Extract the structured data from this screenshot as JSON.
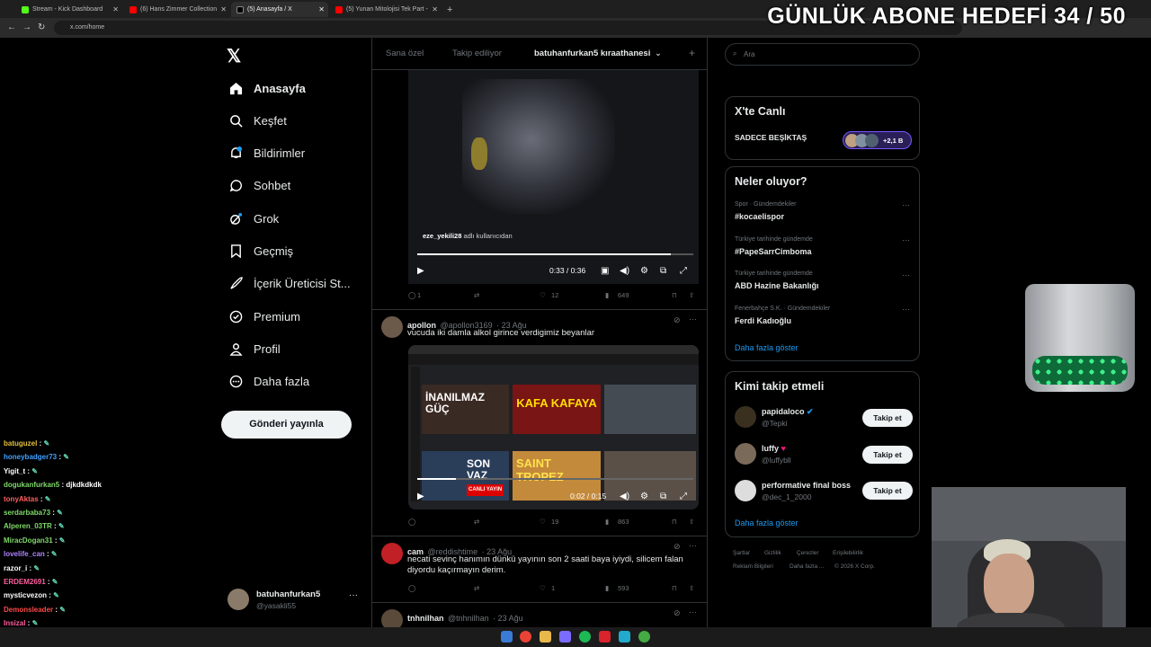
{
  "browser": {
    "tabs": [
      {
        "title": "Stream - Kick Dashboard",
        "color": "#53fc18",
        "active": false
      },
      {
        "title": "(6) Hans Zimmer Collection",
        "color": "#ff0000",
        "active": false
      },
      {
        "title": "(5) Anasayfa / X",
        "color": "#000000",
        "active": true
      },
      {
        "title": "(5) Yunan Mitolojisi Tek Part -",
        "color": "#ff0000",
        "active": false
      }
    ],
    "url": "x.com/home"
  },
  "overlay": {
    "goal_text": "GÜNLÜK ABONE HEDEFİ 34 / 50"
  },
  "sidebar": {
    "items": [
      {
        "label": "Anasayfa",
        "icon": "home-icon"
      },
      {
        "label": "Keşfet",
        "icon": "search-icon"
      },
      {
        "label": "Bildirimler",
        "icon": "bell-icon"
      },
      {
        "label": "Sohbet",
        "icon": "chat-icon"
      },
      {
        "label": "Grok",
        "icon": "grok-icon"
      },
      {
        "label": "Geçmiş",
        "icon": "bookmark-icon"
      },
      {
        "label": "İçerik Üreticisi St...",
        "icon": "rocket-icon"
      },
      {
        "label": "Premium",
        "icon": "premium-icon"
      },
      {
        "label": "Profil",
        "icon": "profile-icon"
      },
      {
        "label": "Daha fazla",
        "icon": "more-icon"
      }
    ],
    "post_button": "Gönderi yayınla",
    "account": {
      "name": "batuhanfurkan5",
      "handle": "@yasakli55"
    }
  },
  "timeline": {
    "tabs": [
      "Sana özel",
      "Takip ediliyor",
      "batuhanfurkan5 kıraathanesi"
    ],
    "video1": {
      "caption": "eze_yekili28 adlı kullanıcıdan",
      "time": "0:33 / 0:36",
      "replies": "1",
      "likes": "12",
      "views": "649"
    },
    "post2": {
      "name": "apollon",
      "handle": "@apollon3169",
      "date": "· 23 Ağu",
      "text": "vucuda iki damla alkol girince verdigimiz beyanlar",
      "time": "0:02 / 0:15",
      "likes": "19",
      "views": "863",
      "thumbs": [
        "İNANILMAZ GÜÇ",
        "KAFA KAFAYA",
        "SON VAZ",
        "SAINT TROPEZ",
        "CANLI YAYIN"
      ]
    },
    "post3": {
      "name": "cam",
      "handle": "@reddishtime",
      "date": "· 23 Ağu",
      "text1": "necati sevinç hanımın dünkü yayının son 2 saati baya iyiydi, silicem falan",
      "text2": "diyordu kaçırmayın derim.",
      "likes": "1",
      "views": "593"
    },
    "post4": {
      "name": "tnhnilhan",
      "handle": "@tnhnilhan",
      "date": "· 23 Ağu"
    }
  },
  "right": {
    "search_placeholder": "Ara",
    "live": {
      "title": "X'te Canlı",
      "stream": "SADECE BEŞİKTAŞ",
      "count": "+2,1 B"
    },
    "trends": {
      "title": "Neler oluyor?",
      "items": [
        {
          "meta": "Spor · Gündemdekiler",
          "tag": "#kocaelispor"
        },
        {
          "meta": "Türkiye tarihinde gündemde",
          "tag": "#PapeSarrCimboma"
        },
        {
          "meta": "Türkiye tarihinde gündemde",
          "tag": "ABD Hazine Bakanlığı"
        },
        {
          "meta": "Fenerbahçe S.K. · Gündemdekiler",
          "tag": "Ferdi Kadıoğlu"
        }
      ],
      "show_more": "Daha fazla göster"
    },
    "who": {
      "title": "Kimi takip etmeli",
      "items": [
        {
          "name": "papidaloco",
          "handle": "@Tepki"
        },
        {
          "name": "luffy",
          "handle": "@luffybll"
        },
        {
          "name": "performative final boss",
          "handle": "@dec_1_2000"
        }
      ],
      "follow_label": "Takip et",
      "show_more": "Daha fazla göster"
    },
    "footer": [
      "Şartlar",
      "Gizlilik",
      "Çerezler",
      "Erişilebilirlik",
      "Reklam Bilgileri",
      "Daha fazla ...",
      "© 2026 X Corp."
    ]
  },
  "chat": [
    {
      "user": "batuguzel",
      "msg": "",
      "color": "#e6c13b"
    },
    {
      "user": "honeybadger73",
      "msg": "",
      "color": "#3fa0ff"
    },
    {
      "user": "Yigit_t",
      "msg": "",
      "color": "#ffffff"
    },
    {
      "user": "dogukanfurkan5",
      "msg": "djkdkdkdk",
      "color": "#7fd96a"
    },
    {
      "user": "tonyAktas",
      "msg": "",
      "color": "#ff5f5f"
    },
    {
      "user": "serdarbaba73",
      "msg": "",
      "color": "#7fd96a"
    },
    {
      "user": "Alperen_03TR",
      "msg": "",
      "color": "#7fd96a"
    },
    {
      "user": "MiracDogan31",
      "msg": "",
      "color": "#7fd96a"
    },
    {
      "user": "lovelife_can",
      "msg": "",
      "color": "#b084ff"
    },
    {
      "user": "razor_i",
      "msg": "",
      "color": "#ffffff"
    },
    {
      "user": "ERDEM2691",
      "msg": "",
      "color": "#ff5f9e"
    },
    {
      "user": "mysticvezon",
      "msg": "",
      "color": "#ffffff"
    },
    {
      "user": "Demonsleader",
      "msg": "",
      "color": "#ff4a4a"
    },
    {
      "user": "Insizal",
      "msg": "",
      "color": "#ff5f9e"
    }
  ]
}
